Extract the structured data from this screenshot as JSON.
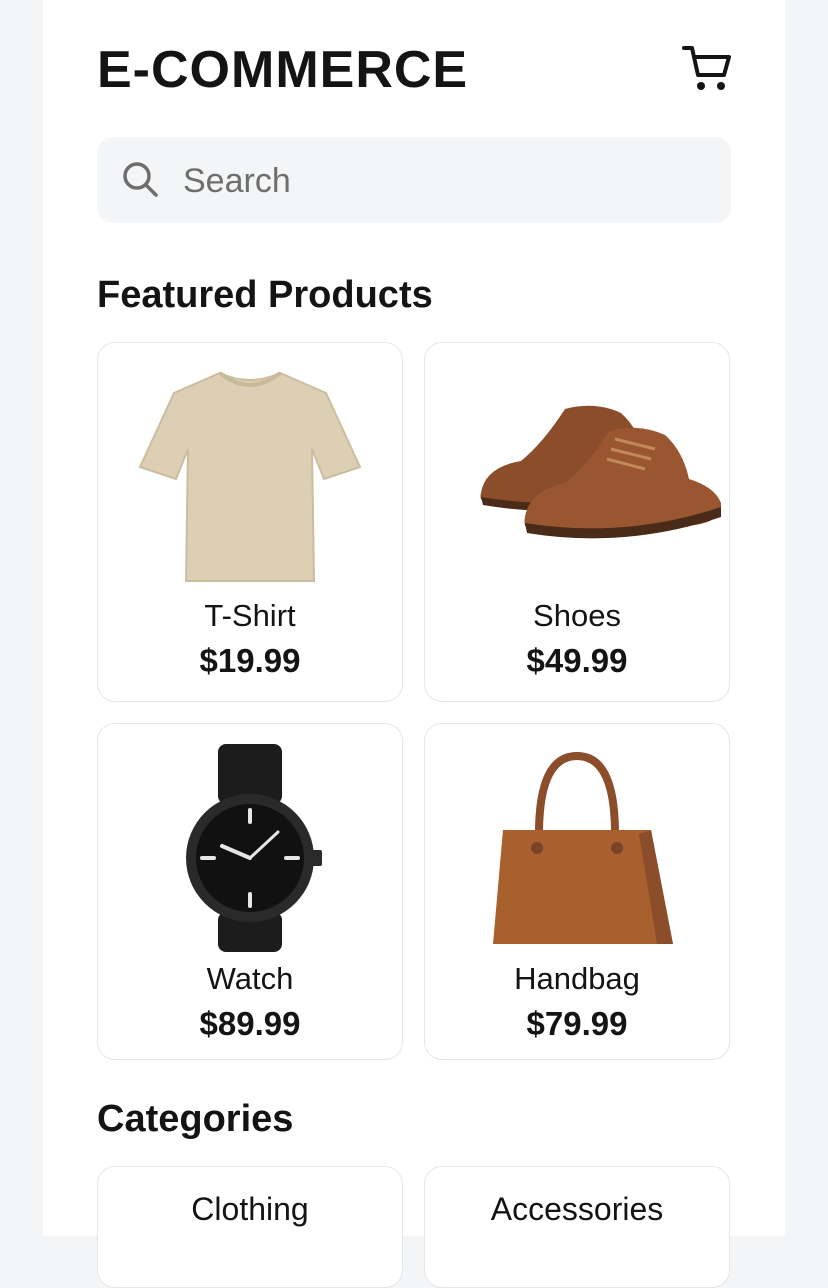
{
  "header": {
    "title": "E-COMMERCE",
    "cart_icon": "shopping-cart-icon"
  },
  "search": {
    "placeholder": "Search",
    "icon": "search-icon"
  },
  "featured": {
    "title": "Featured Products",
    "products": [
      {
        "name": "T-Shirt",
        "price": "$19.99",
        "image": "t-shirt-image"
      },
      {
        "name": "Shoes",
        "price": "$49.99",
        "image": "shoes-image"
      },
      {
        "name": "Watch",
        "price": "$89.99",
        "image": "watch-image"
      },
      {
        "name": "Handbag",
        "price": "$79.99",
        "image": "handbag-image"
      }
    ]
  },
  "categories": {
    "title": "Categories",
    "items": [
      {
        "label": "Clothing"
      },
      {
        "label": "Accessories"
      }
    ]
  },
  "colors": {
    "tshirt": "#dccfb4",
    "leather": "#8b4d2a",
    "handbag": "#a8602f",
    "watch": "#1a1a1a"
  }
}
